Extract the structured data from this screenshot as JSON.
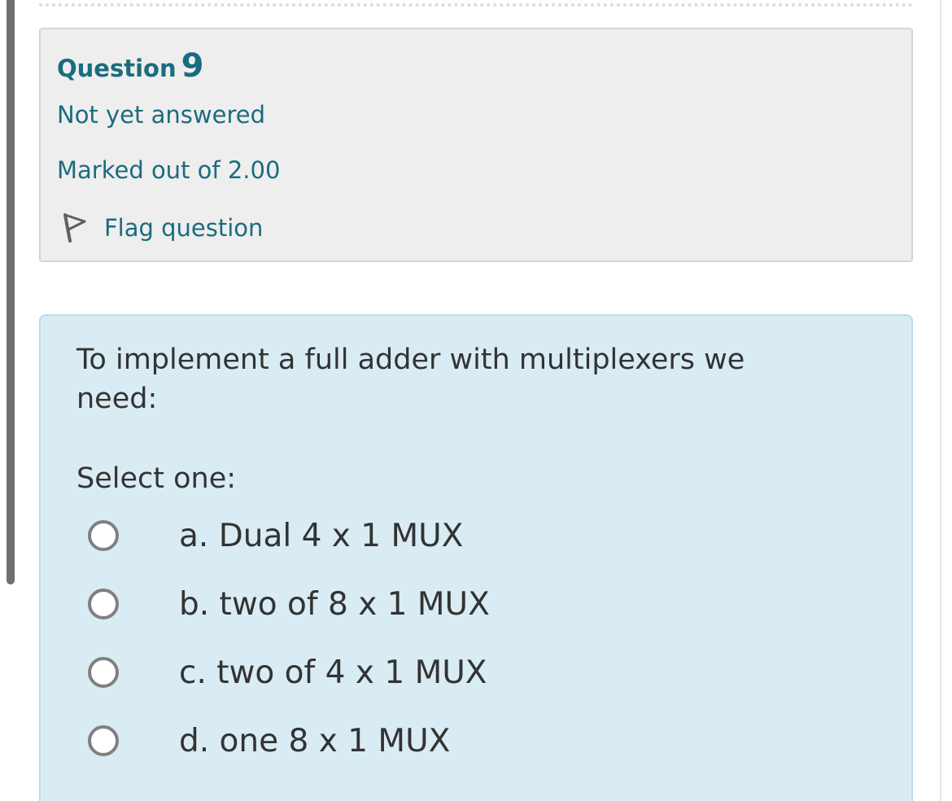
{
  "question": {
    "title_word": "Question",
    "number": "9",
    "state": "Not yet answered",
    "grade": "Marked out of 2.00",
    "flag_label": "Flag question"
  },
  "content": {
    "text": "To implement a full adder with multiplexers we need:",
    "prompt": "Select one:",
    "answers": [
      {
        "label": "a. Dual 4 x 1 MUX",
        "selected": false
      },
      {
        "label": "b. two of 8 x 1 MUX",
        "selected": false
      },
      {
        "label": "c. two of 4 x 1 MUX",
        "selected": false
      },
      {
        "label": "d. one 8 x 1 MUX",
        "selected": false
      }
    ]
  },
  "colors": {
    "accent": "#1a6c7e",
    "info_bg": "#eeeeee",
    "content_bg": "#d9ecf4",
    "text": "#333333"
  },
  "icons": {
    "flag": "flag-icon",
    "radio": "radio-unchecked-icon"
  }
}
